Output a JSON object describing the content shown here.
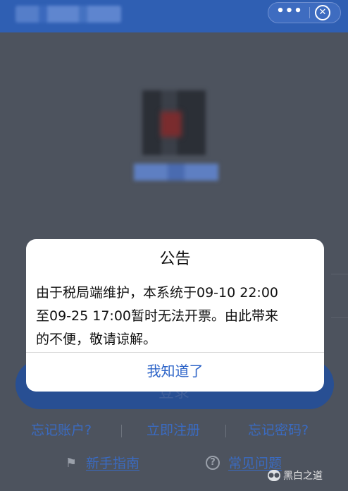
{
  "topbar": {
    "title": "",
    "more_label": "•••",
    "close_label": "✕"
  },
  "background": {
    "app_name": "",
    "login_label": "登录",
    "links": {
      "forgot_account": "忘记账户?",
      "register": "立即注册",
      "forgot_password": "忘记密码?",
      "guide": "新手指南",
      "faq": "常见问题"
    }
  },
  "modal": {
    "title": "公告",
    "body_lines": [
      "由于税局端维护，本系统于09-10 22:00",
      "至09-25 17:00暂时无法开票。由此带来",
      "的不便，敬请谅解。"
    ],
    "ok_label": "我知道了"
  },
  "watermark": {
    "text": "黑白之道"
  },
  "icons": {
    "more": "more-dots-icon",
    "close": "close-circle-icon",
    "guide": "guide-icon",
    "help": "question-circle-icon",
    "wechat": "wechat-icon"
  },
  "colors": {
    "topbar": "#2f5fb3",
    "overlay": "#4d535e",
    "link": "#3a6bc2",
    "modal_button": "#2d64c8"
  }
}
